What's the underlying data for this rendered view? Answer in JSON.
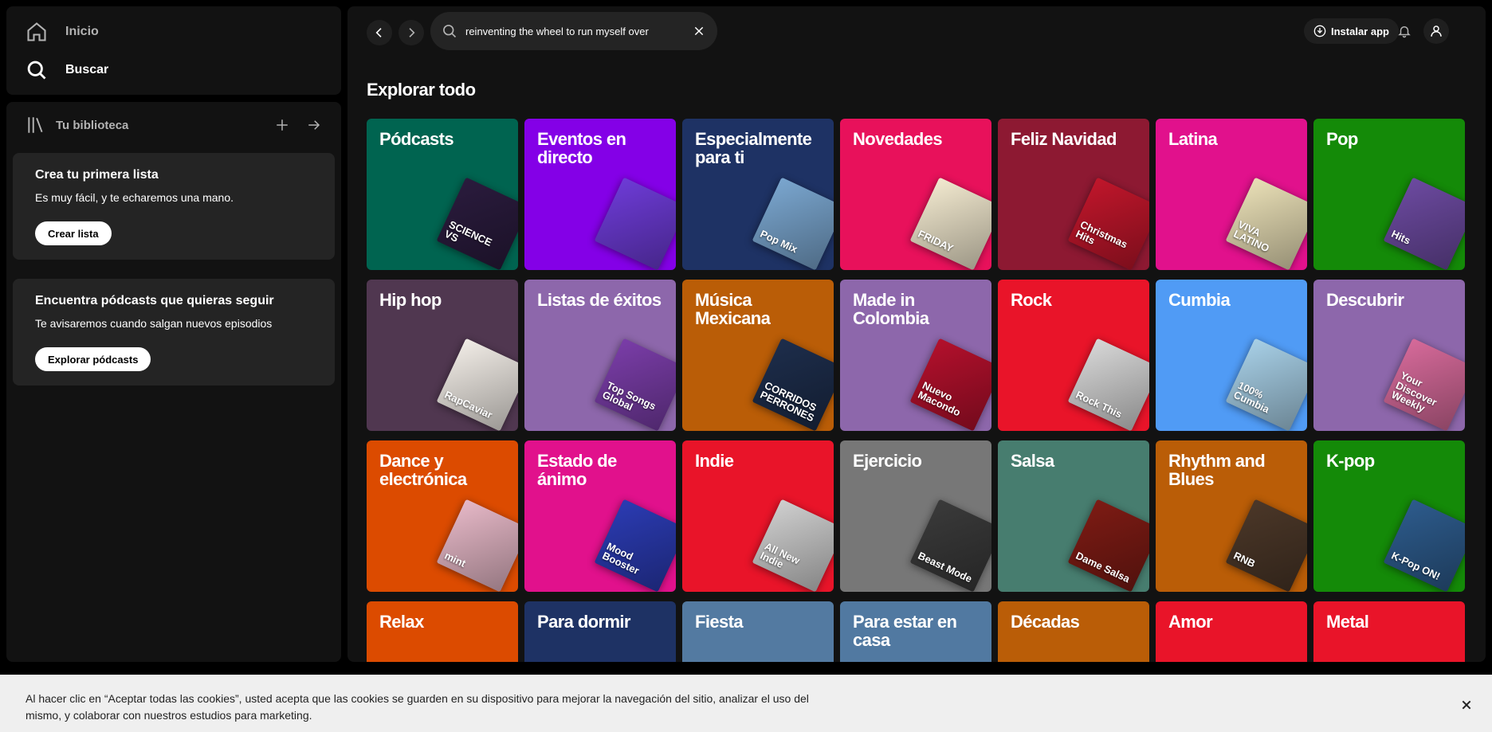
{
  "nav": {
    "home": "Inicio",
    "search": "Buscar"
  },
  "library": {
    "title": "Tu biblioteca",
    "cards": [
      {
        "title": "Crea tu primera lista",
        "text": "Es muy fácil, y te echaremos una mano.",
        "button": "Crear lista"
      },
      {
        "title": "Encuentra pódcasts que quieras seguir",
        "text": "Te avisaremos cuando salgan nuevos episodios",
        "button": "Explorar pódcasts"
      }
    ]
  },
  "topbar": {
    "search_value": "reinventing the wheel to run myself over",
    "install": "Instalar app"
  },
  "section_title": "Explorar todo",
  "tiles": [
    {
      "label": "Pódcasts",
      "bg": "#006450",
      "art": "#2a1b3d",
      "art_text": "SCIENCE VS"
    },
    {
      "label": "Eventos en directo",
      "bg": "#8400e7",
      "art": "#6d3bd6",
      "art_text": ""
    },
    {
      "label": "Especialmente para ti",
      "bg": "#1e3264",
      "art": "#7aa6cf",
      "art_text": "Pop Mix"
    },
    {
      "label": "Novedades",
      "bg": "#e8115b",
      "art": "#f2e9cf",
      "art_text": "FRIDAY"
    },
    {
      "label": "Feliz Navidad",
      "bg": "#8d1932",
      "art": "#c0162b",
      "art_text": "Christmas Hits"
    },
    {
      "label": "Latina",
      "bg": "#e1118c",
      "art": "#e9dfb6",
      "art_text": "VIVA LATINO"
    },
    {
      "label": "Pop",
      "bg": "#148a08",
      "art": "#6c4aa0",
      "art_text": "Hits"
    },
    {
      "label": "Hip hop",
      "bg": "#503750",
      "art": "#f1ece6",
      "art_text": "RapCaviar"
    },
    {
      "label": "Listas de éxitos",
      "bg": "#8d67ab",
      "art": "#7a3da8",
      "art_text": "Top Songs Global"
    },
    {
      "label": "Música Mexicana",
      "bg": "#ba5d07",
      "art": "#1d2d4b",
      "art_text": "CORRIDOS PERRONES"
    },
    {
      "label": "Made in Colombia",
      "bg": "#8d67ab",
      "art": "#b3102c",
      "art_text": "Nuevo Macondo"
    },
    {
      "label": "Rock",
      "bg": "#e91429",
      "art": "#d7d7d7",
      "art_text": "Rock This"
    },
    {
      "label": "Cumbia",
      "bg": "#509bf5",
      "art": "#a7cfe6",
      "art_text": "100% Cumbia"
    },
    {
      "label": "Descubrir",
      "bg": "#8d67ab",
      "art": "#d66a9a",
      "art_text": "Your Discover Weekly"
    },
    {
      "label": "Dance y electrónica",
      "bg": "#dc4b00",
      "art": "#e6b8c7",
      "art_text": "mint"
    },
    {
      "label": "Estado de ánimo",
      "bg": "#e1118c",
      "art": "#2b3bb3",
      "art_text": "Mood Booster"
    },
    {
      "label": "Indie",
      "bg": "#e91429",
      "art": "#cfcfcf",
      "art_text": "All New Indie"
    },
    {
      "label": "Ejercicio",
      "bg": "#777777",
      "art": "#3a3a3a",
      "art_text": "Beast Mode"
    },
    {
      "label": "Salsa",
      "bg": "#477d6f",
      "art": "#7d1b14",
      "art_text": "Dame Salsa"
    },
    {
      "label": "Rhythm and Blues",
      "bg": "#ba5d07",
      "art": "#4b3728",
      "art_text": "RNB"
    },
    {
      "label": "K-pop",
      "bg": "#148a08",
      "art": "#2d5b8c",
      "art_text": "K-Pop ON!"
    },
    {
      "label": "Relax",
      "bg": "#dc4b00",
      "art": "#dc4b00",
      "art_text": ""
    },
    {
      "label": "Para dormir",
      "bg": "#1e3264",
      "art": "#1e3264",
      "art_text": ""
    },
    {
      "label": "Fiesta",
      "bg": "#537aa1",
      "art": "#537aa1",
      "art_text": ""
    },
    {
      "label": "Para estar en casa",
      "bg": "#5179a1",
      "art": "#5179a1",
      "art_text": ""
    },
    {
      "label": "Décadas",
      "bg": "#ba5d07",
      "art": "#ba5d07",
      "art_text": ""
    },
    {
      "label": "Amor",
      "bg": "#e91429",
      "art": "#e91429",
      "art_text": ""
    },
    {
      "label": "Metal",
      "bg": "#e91429",
      "art": "#e91429",
      "art_text": ""
    }
  ],
  "cookie": {
    "text": "Al hacer clic en “Aceptar todas las cookies”, usted acepta que las cookies se guarden en su dispositivo para mejorar la navegación del sitio, analizar el uso del mismo, y colaborar con nuestros estudios para marketing."
  }
}
